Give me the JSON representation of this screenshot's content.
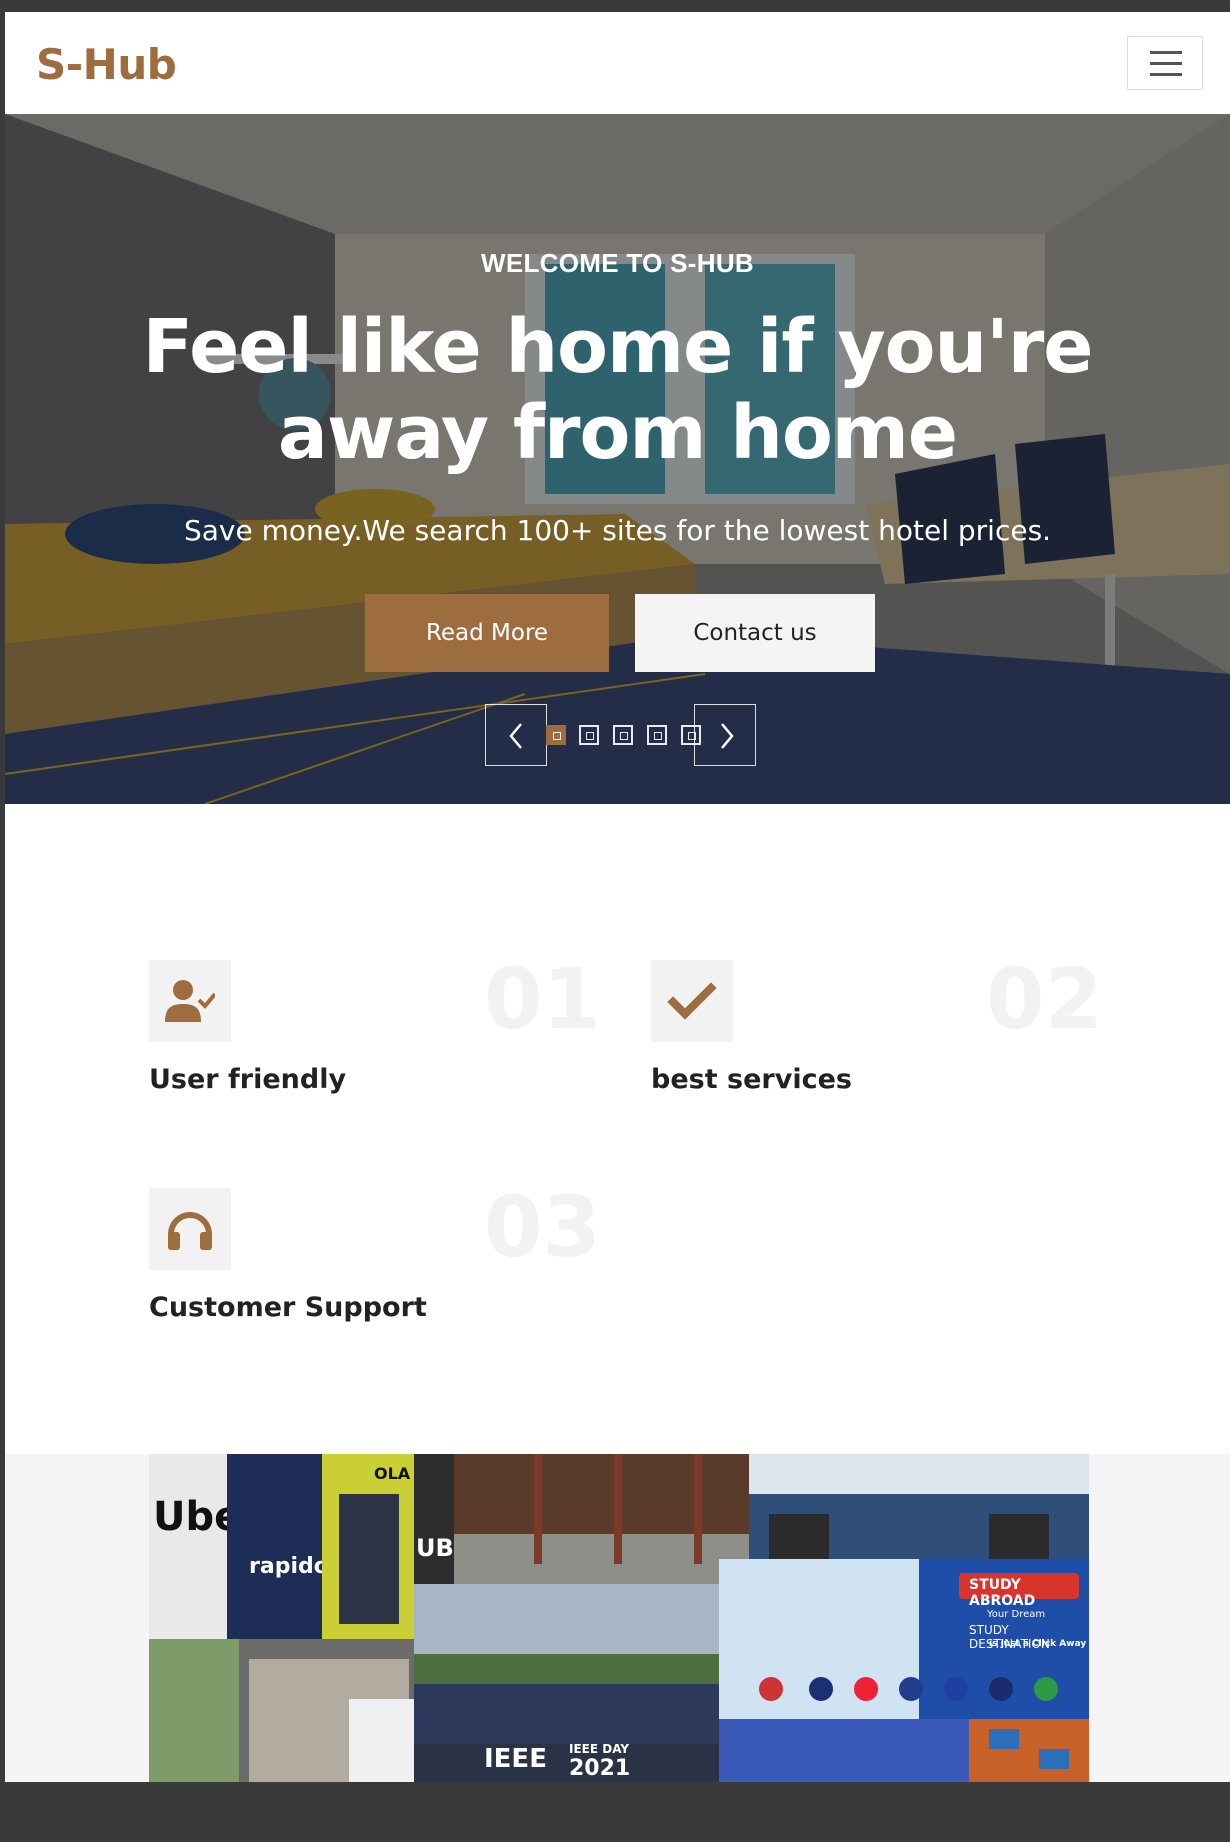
{
  "navbar": {
    "brand": "S-Hub",
    "menu_icon": "hamburger-icon"
  },
  "hero": {
    "kicker": "WELCOME TO S-HUB",
    "headline_line1": "Feel like home if you're",
    "headline_line2": "away from home",
    "tagline": "Save money.We search 100+ sites for the lowest hotel prices.",
    "primary_button": "Read More",
    "secondary_button": "Contact us",
    "carousel": {
      "slides": 5,
      "active_index": 0
    }
  },
  "features": [
    {
      "number": "01",
      "title": "User friendly",
      "icon": "user-check-icon"
    },
    {
      "number": "02",
      "title": "best services",
      "icon": "check-icon"
    },
    {
      "number": "03",
      "title": "Customer Support",
      "icon": "headphones-icon"
    }
  ],
  "gallery": {
    "tile_texts": [
      "Uber",
      "rapido",
      "OLA",
      "UB",
      "STUDY ABROAD",
      "Your Dream",
      "STUDY DESTINATION",
      "is just a Click Away",
      "IEEE",
      "IEEE DAY",
      "2021"
    ]
  },
  "colors": {
    "accent": "#9e6d3f",
    "light": "#f4f4f4",
    "frame": "#3a3a3a"
  }
}
